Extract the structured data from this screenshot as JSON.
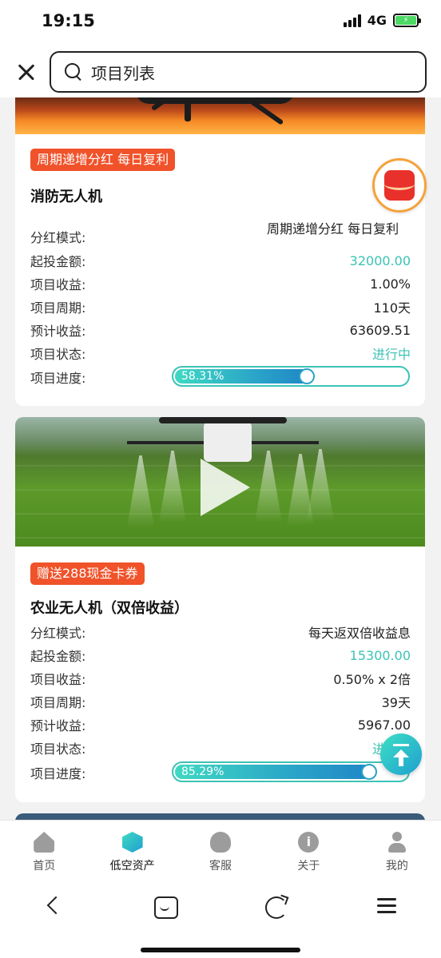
{
  "status_bar": {
    "time": "19:15",
    "network": "4G"
  },
  "search": {
    "text": "项目列表"
  },
  "cards": [
    {
      "tag": "周期递增分红 每日复利",
      "title": "消防无人机",
      "rows": [
        {
          "label": "分红模式:",
          "value": "周期递增分红  每日复利"
        },
        {
          "label": "起投金额:",
          "value": "32000.00"
        },
        {
          "label": "项目收益:",
          "value": "1.00%"
        },
        {
          "label": "项目周期:",
          "value": "110天"
        },
        {
          "label": "预计收益:",
          "value": "63609.51"
        },
        {
          "label": "项目状态:",
          "value": "进行中"
        }
      ],
      "progress_label": "项目进度:",
      "progress_text": "58.31%",
      "progress_fraction": 0.5831
    },
    {
      "tag": "赠送288现金卡券",
      "title": "农业无人机（双倍收益）",
      "rows": [
        {
          "label": "分红模式:",
          "value": "每天返双倍收益息"
        },
        {
          "label": "起投金额:",
          "value": "15300.00"
        },
        {
          "label": "项目收益:",
          "value": "0.50% x 2倍"
        },
        {
          "label": "项目周期:",
          "value": "39天"
        },
        {
          "label": "预计收益:",
          "value": "5967.00"
        },
        {
          "label": "项目状态:",
          "value": "进"
        }
      ],
      "progress_label": "项目进度:",
      "progress_text": "85.29%",
      "progress_fraction": 0.8529
    }
  ],
  "tabbar": [
    {
      "label": "首页",
      "icon": "home-icon"
    },
    {
      "label": "低空资产",
      "icon": "cube-icon",
      "active": true
    },
    {
      "label": "客服",
      "icon": "headset-icon"
    },
    {
      "label": "关于",
      "icon": "info-icon"
    },
    {
      "label": "我的",
      "icon": "user-icon"
    }
  ],
  "colors": {
    "accent_teal": "#3cc3b5",
    "tag_orange": "#f0522a"
  }
}
